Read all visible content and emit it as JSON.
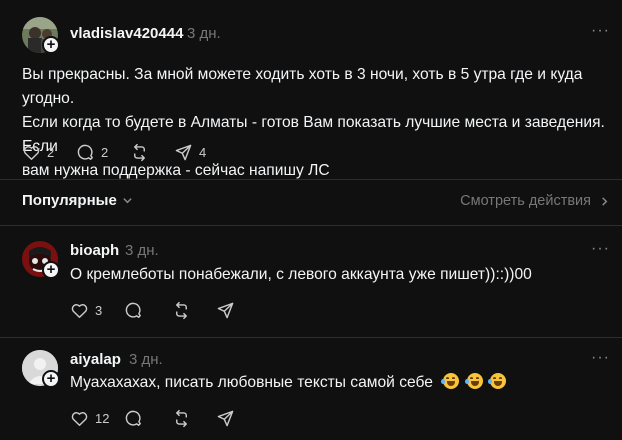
{
  "post": {
    "username": "vladislav420444",
    "time": "3 дн.",
    "text_lines": [
      "Вы прекрасны. За мной можете ходить хоть в 3 ночи, хоть в 5 утра где и куда угодно.",
      "Если когда то будете в Алматы - готов Вам показать лучшие места и заведения. Если",
      "вам нужна поддержка - сейчас напишу ЛС"
    ],
    "likes": "2",
    "replies": "2",
    "reposts": "",
    "shares": "4"
  },
  "toolbar": {
    "sort_label": "Популярные",
    "view_activity_label": "Смотреть действия"
  },
  "comments": [
    {
      "username": "bioaph",
      "time": "3 дн.",
      "text": "О кремлеботы понабежали, с левого аккаунта уже пишет))::))00",
      "likes": "3"
    },
    {
      "username": "aiyalap",
      "time": "3 дн.",
      "text": "Муахахахах, писать любовные тексты самой себе",
      "likes": "12"
    }
  ],
  "icons": {
    "like": "heart-icon",
    "reply": "comment-icon",
    "repost": "repost-icon",
    "share": "send-icon",
    "more": "more-icon",
    "follow": "plus-icon",
    "chevron": "chevron-icon",
    "emoji": "rolling-on-floor-laughing-emoji"
  },
  "colors": {
    "background": "#101010",
    "text": "#f3f5f7",
    "secondary": "#777777",
    "divider": "#2d2d2d"
  }
}
